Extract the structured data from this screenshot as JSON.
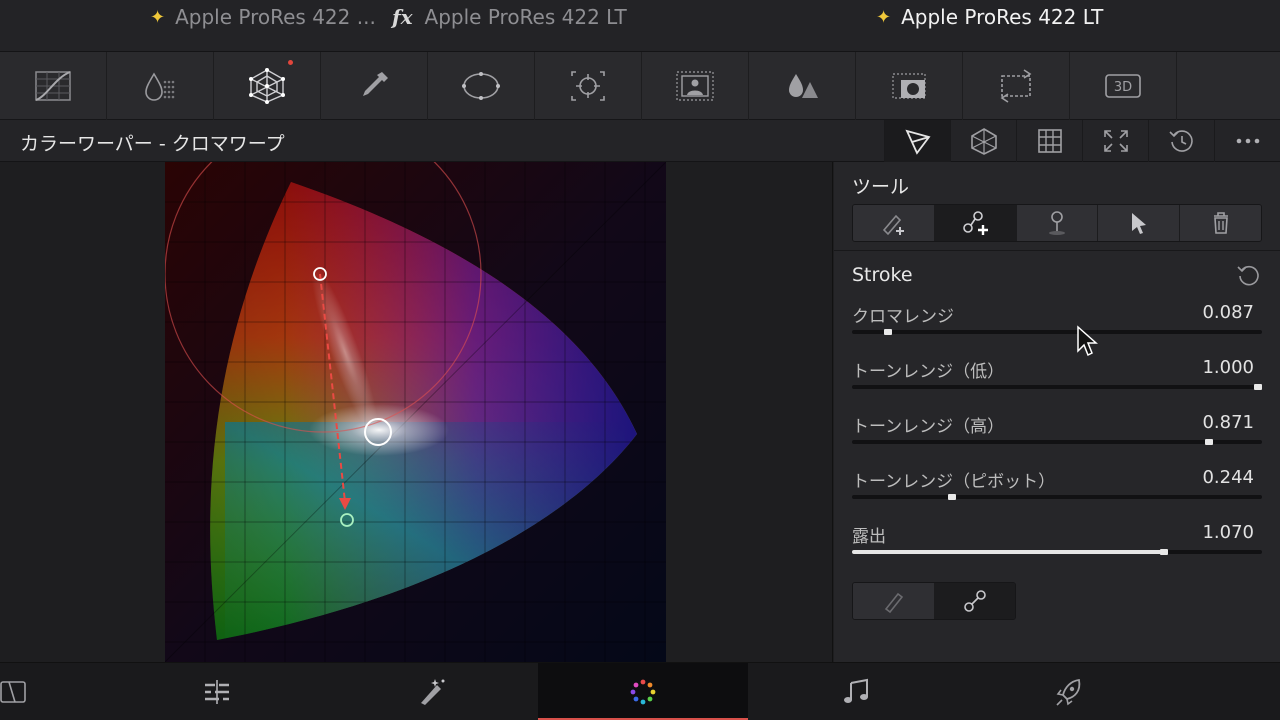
{
  "clips": [
    {
      "label": "Apple ProRes 422 ...",
      "icon": "sparkle-icon"
    },
    {
      "label": "Apple ProRes 422 LT",
      "icon": "fx-icon",
      "fx": "fx"
    },
    {
      "label": "Apple ProRes 422 LT",
      "icon": "sparkle-icon"
    }
  ],
  "palette_icons": [
    "curves-icon",
    "color-qualifier-icon",
    "color-warper-icon",
    "eyedropper-icon",
    "window-icon",
    "tracker-icon",
    "magic-mask-icon",
    "blur-icon",
    "key-icon",
    "sizing-icon",
    "3d-icon"
  ],
  "palette_3d_label": "3D",
  "panel": {
    "title": "カラーワーパー - クロマワープ",
    "header_icons": [
      "chroma-warp-icon",
      "hue-sat-icon",
      "grid-icon",
      "expand-icon",
      "reset-all-icon",
      "more-icon"
    ]
  },
  "tools": {
    "title": "ツール",
    "buttons": [
      "add-point-icon",
      "add-mesh-point-icon",
      "pin-icon",
      "select-arrow-icon",
      "trash-icon"
    ],
    "active_index": 1
  },
  "stroke": {
    "title": "Stroke",
    "params": [
      {
        "label": "クロマレンジ",
        "value": "0.087",
        "position": 0.087
      },
      {
        "label": "トーンレンジ（低）",
        "value": "1.000",
        "position": 1.0
      },
      {
        "label": "トーンレンジ（高）",
        "value": "0.871",
        "position": 0.871
      },
      {
        "label": "トーンレンジ（ピボット）",
        "value": "0.244",
        "position": 0.244
      },
      {
        "label": "露出",
        "value": "1.070",
        "position": 0.76
      }
    ]
  },
  "bottom_icons": [
    "cut-page-icon",
    "edit-page-icon",
    "fusion-page-icon",
    "color-page-icon",
    "fairlight-page-icon",
    "deliver-page-icon"
  ],
  "colors": {
    "accent": "#d8504a",
    "background": "#1e1e20",
    "panel": "#262629",
    "sparkle": "#f0c83a"
  }
}
